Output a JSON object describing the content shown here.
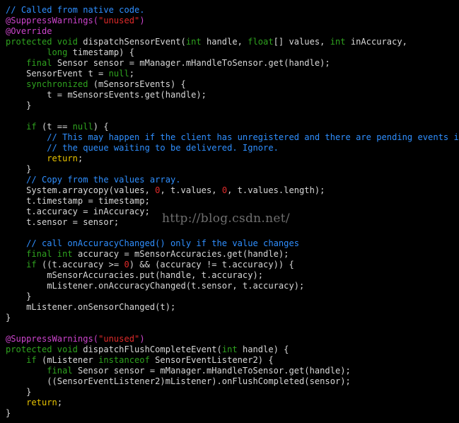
{
  "editor": {
    "colors": {
      "background": "#000000",
      "plain": "#d8d8d8",
      "comment": "#2f8fff",
      "keyword": "#2fa31f",
      "annotation": "#cc44cc",
      "string": "#e02a2a",
      "number": "#e02a2a",
      "return_keyword": "#e8c300"
    },
    "lines": [
      [
        [
          "comment",
          "// Called from native code."
        ]
      ],
      [
        [
          "annotation",
          "@SuppressWarnings("
        ],
        [
          "string",
          "\"unused\""
        ],
        [
          "annotation",
          ")"
        ]
      ],
      [
        [
          "annotation",
          "@Override"
        ]
      ],
      [
        [
          "keyword",
          "protected void "
        ],
        [
          "plain",
          "dispatchSensorEvent("
        ],
        [
          "keyword",
          "int "
        ],
        [
          "plain",
          "handle, "
        ],
        [
          "keyword",
          "float"
        ],
        [
          "plain",
          "[] values, "
        ],
        [
          "keyword",
          "int "
        ],
        [
          "plain",
          "inAccuracy,"
        ]
      ],
      [
        [
          "plain",
          "        "
        ],
        [
          "keyword",
          "long "
        ],
        [
          "plain",
          "timestamp) {"
        ]
      ],
      [
        [
          "plain",
          "    "
        ],
        [
          "keyword",
          "final "
        ],
        [
          "plain",
          "Sensor sensor = mManager.mHandleToSensor.get(handle);"
        ]
      ],
      [
        [
          "plain",
          "    SensorEvent t = "
        ],
        [
          "keyword",
          "null"
        ],
        [
          "plain",
          ";"
        ]
      ],
      [
        [
          "plain",
          "    "
        ],
        [
          "keyword",
          "synchronized "
        ],
        [
          "plain",
          "(mSensorsEvents) {"
        ]
      ],
      [
        [
          "plain",
          "        t = mSensorsEvents.get(handle);"
        ]
      ],
      [
        [
          "plain",
          "    }"
        ]
      ],
      [
        [
          "plain",
          ""
        ]
      ],
      [
        [
          "plain",
          "    "
        ],
        [
          "keyword",
          "if "
        ],
        [
          "plain",
          "(t == "
        ],
        [
          "keyword",
          "null"
        ],
        [
          "plain",
          ") {"
        ]
      ],
      [
        [
          "plain",
          "        "
        ],
        [
          "comment",
          "// This may happen if the client has unregistered and there are pending events in"
        ]
      ],
      [
        [
          "plain",
          "        "
        ],
        [
          "comment",
          "// the queue waiting to be delivered. Ignore."
        ]
      ],
      [
        [
          "plain",
          "        "
        ],
        [
          "return_keyword",
          "return"
        ],
        [
          "plain",
          ";"
        ]
      ],
      [
        [
          "plain",
          "    }"
        ]
      ],
      [
        [
          "plain",
          "    "
        ],
        [
          "comment",
          "// Copy from the values array."
        ]
      ],
      [
        [
          "plain",
          "    System.arraycopy(values, "
        ],
        [
          "number",
          "0"
        ],
        [
          "plain",
          ", t.values, "
        ],
        [
          "number",
          "0"
        ],
        [
          "plain",
          ", t.values.length);"
        ]
      ],
      [
        [
          "plain",
          "    t.timestamp = timestamp;"
        ]
      ],
      [
        [
          "plain",
          "    t.accuracy = inAccuracy;"
        ]
      ],
      [
        [
          "plain",
          "    t.sensor = sensor;"
        ]
      ],
      [
        [
          "plain",
          ""
        ]
      ],
      [
        [
          "plain",
          "    "
        ],
        [
          "comment",
          "// call onAccuracyChanged() only if the value changes"
        ]
      ],
      [
        [
          "plain",
          "    "
        ],
        [
          "keyword",
          "final int "
        ],
        [
          "plain",
          "accuracy = mSensorAccuracies.get(handle);"
        ]
      ],
      [
        [
          "plain",
          "    "
        ],
        [
          "keyword",
          "if "
        ],
        [
          "plain",
          "((t.accuracy >= "
        ],
        [
          "number",
          "0"
        ],
        [
          "plain",
          ") && (accuracy != t.accuracy)) {"
        ]
      ],
      [
        [
          "plain",
          "        mSensorAccuracies.put(handle, t.accuracy);"
        ]
      ],
      [
        [
          "plain",
          "        mListener.onAccuracyChanged(t.sensor, t.accuracy);"
        ]
      ],
      [
        [
          "plain",
          "    }"
        ]
      ],
      [
        [
          "plain",
          "    mListener.onSensorChanged(t);"
        ]
      ],
      [
        [
          "plain",
          "}"
        ]
      ],
      [
        [
          "plain",
          ""
        ]
      ],
      [
        [
          "annotation",
          "@SuppressWarnings("
        ],
        [
          "string",
          "\"unused\""
        ],
        [
          "annotation",
          ")"
        ]
      ],
      [
        [
          "keyword",
          "protected void "
        ],
        [
          "plain",
          "dispatchFlushCompleteEvent("
        ],
        [
          "keyword",
          "int "
        ],
        [
          "plain",
          "handle) {"
        ]
      ],
      [
        [
          "plain",
          "    "
        ],
        [
          "keyword",
          "if "
        ],
        [
          "plain",
          "(mListener "
        ],
        [
          "keyword",
          "instanceof "
        ],
        [
          "plain",
          "SensorEventListener2) {"
        ]
      ],
      [
        [
          "plain",
          "        "
        ],
        [
          "keyword",
          "final "
        ],
        [
          "plain",
          "Sensor sensor = mManager.mHandleToSensor.get(handle);"
        ]
      ],
      [
        [
          "plain",
          "        ((SensorEventListener2)mListener).onFlushCompleted(sensor);"
        ]
      ],
      [
        [
          "plain",
          "    }"
        ]
      ],
      [
        [
          "plain",
          "    "
        ],
        [
          "return_keyword",
          "return"
        ],
        [
          "plain",
          ";"
        ]
      ],
      [
        [
          "plain",
          "}"
        ]
      ]
    ]
  },
  "watermark": {
    "text": "http://blog.csdn.net/"
  }
}
